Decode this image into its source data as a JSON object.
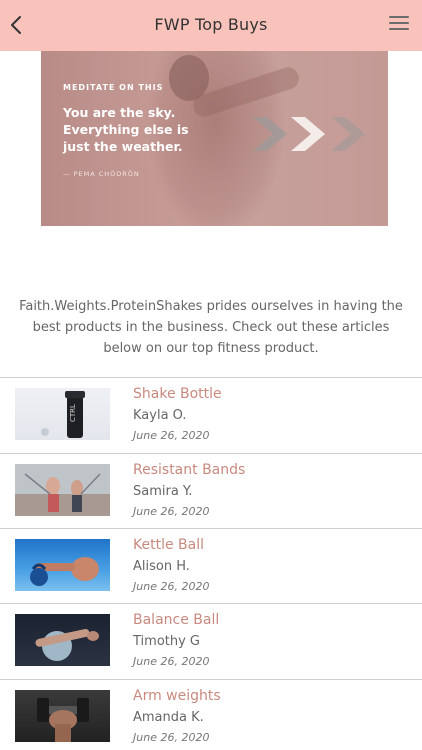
{
  "header": {
    "title": "FWP Top Buys",
    "back_icon": "chevron-left-icon",
    "menu_icon": "hamburger-menu-icon",
    "background_color": "#f9c3bb"
  },
  "hero": {
    "tagline": "MEDITATE ON THIS",
    "quote": "You are the sky. Everything else is just the weather.",
    "attribution": "— PEMA CHÖDRÖN"
  },
  "intro": {
    "text": "Faith.Weights.ProteinShakes prides ourselves in having the best products in the business. Check out these articles below on our top fitness product."
  },
  "articles": [
    {
      "title": "Shake Bottle",
      "author": "Kayla O.",
      "date": "June 26, 2020"
    },
    {
      "title": "Resistant Bands",
      "author": "Samira Y.",
      "date": "June 26, 2020"
    },
    {
      "title": "Kettle Ball",
      "author": "Alison H.",
      "date": "June 26, 2020"
    },
    {
      "title": "Balance Ball",
      "author": "Timothy G",
      "date": "June 26, 2020"
    },
    {
      "title": "Arm weights",
      "author": "Amanda K.",
      "date": "June 26, 2020"
    }
  ],
  "colors": {
    "accent": "#c8897f",
    "divider": "#cfcfcf"
  }
}
